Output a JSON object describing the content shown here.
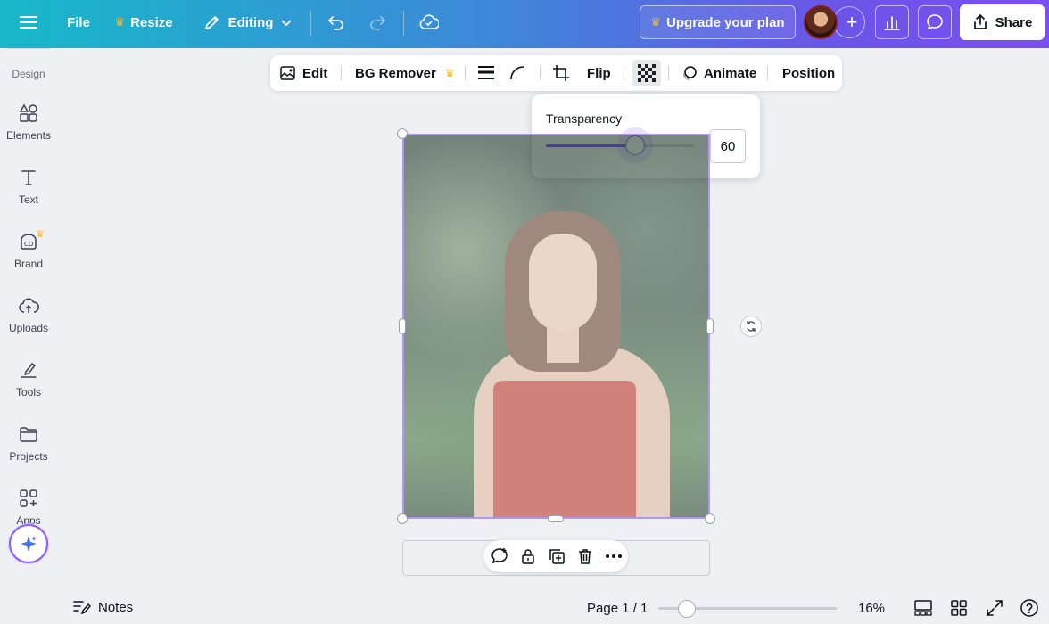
{
  "topbar": {
    "file_label": "File",
    "resize_label": "Resize",
    "editing_label": "Editing",
    "upgrade_label": "Upgrade your plan",
    "share_label": "Share"
  },
  "sidebar": {
    "design_label": "Design",
    "items": [
      {
        "label": "Elements",
        "icon": "elements-icon"
      },
      {
        "label": "Text",
        "icon": "text-icon"
      },
      {
        "label": "Brand",
        "icon": "brand-icon"
      },
      {
        "label": "Uploads",
        "icon": "uploads-icon"
      },
      {
        "label": "Tools",
        "icon": "tools-icon"
      },
      {
        "label": "Projects",
        "icon": "projects-icon"
      },
      {
        "label": "Apps",
        "icon": "apps-icon"
      }
    ]
  },
  "context_toolbar": {
    "edit_label": "Edit",
    "bg_remover_label": "BG Remover",
    "flip_label": "Flip",
    "animate_label": "Animate",
    "position_label": "Position"
  },
  "transparency": {
    "title": "Transparency",
    "value": "60",
    "level_percent": 60
  },
  "bottom": {
    "notes_label": "Notes",
    "page_info": "Page 1 / 1",
    "zoom": "16%",
    "zoom_level_percent": 16
  },
  "colors": {
    "accent": "#8b5cf6",
    "crown": "#f5b82e"
  }
}
